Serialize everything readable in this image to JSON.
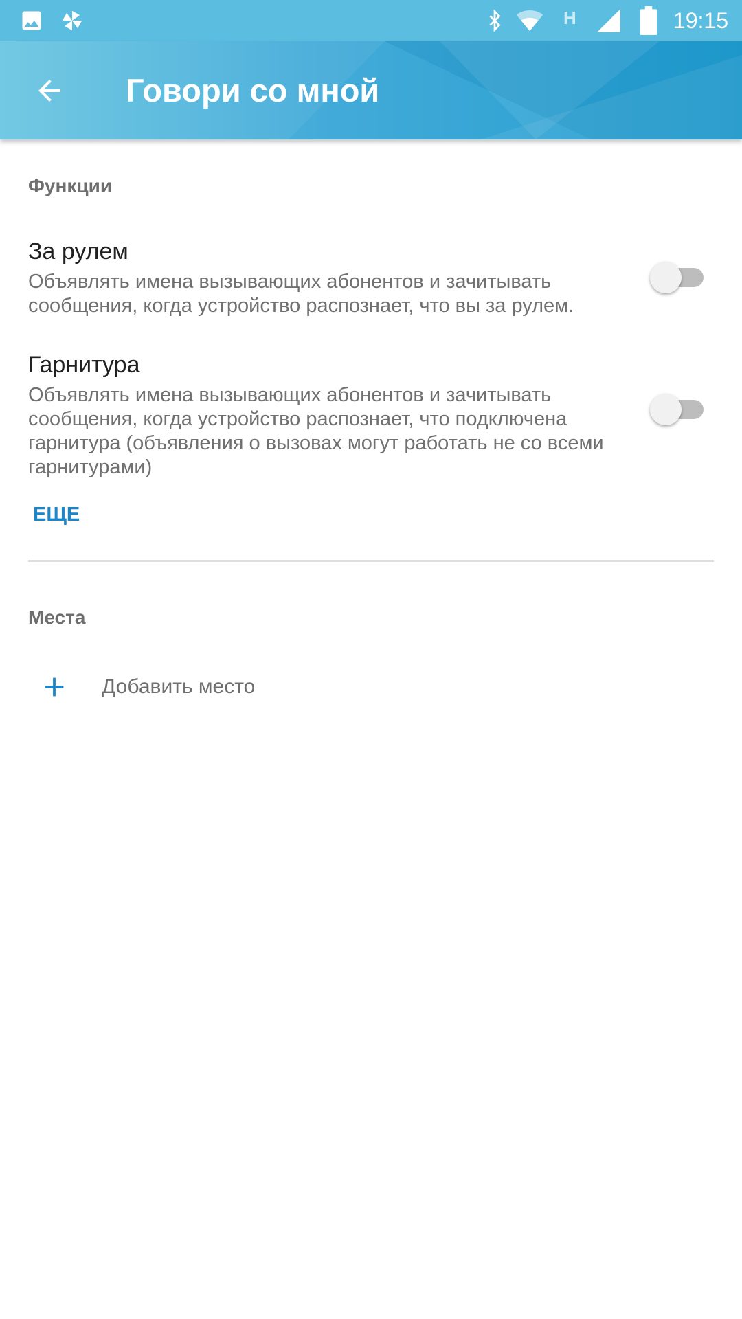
{
  "status_bar": {
    "time": "19:15",
    "network_type": "H",
    "icons": [
      "image-icon",
      "pinwheel-icon",
      "bluetooth-icon",
      "wifi-icon",
      "network-type-icon",
      "signal-icon",
      "battery-icon"
    ]
  },
  "app_bar": {
    "title": "Говори со мной",
    "back_icon": "arrow-back-icon"
  },
  "sections": {
    "functions": {
      "header": "Функции",
      "items": [
        {
          "title": "За рулем",
          "description": "Объявлять имена вызывающих абонентов и зачитывать сообщения, когда устройство распознает, что вы за рулем.",
          "enabled": false
        },
        {
          "title": "Гарнитура",
          "description": "Объявлять имена вызывающих абонентов и зачитывать сообщения, когда устройство распознает, что подключена гарнитура (объявления о вызовах могут работать не со всеми гарнитурами)",
          "enabled": false
        }
      ],
      "more_label": "ЕЩЕ"
    },
    "places": {
      "header": "Места",
      "add_label": "Добавить место",
      "add_icon": "plus-icon"
    }
  },
  "colors": {
    "status_bar": "#5bbde0",
    "app_bar_start": "#6ac6e2",
    "app_bar_end": "#229ed0",
    "accent": "#1c86c8",
    "toggle_track_off": "#bdbdbd",
    "toggle_thumb_off": "#f1f1f1"
  }
}
